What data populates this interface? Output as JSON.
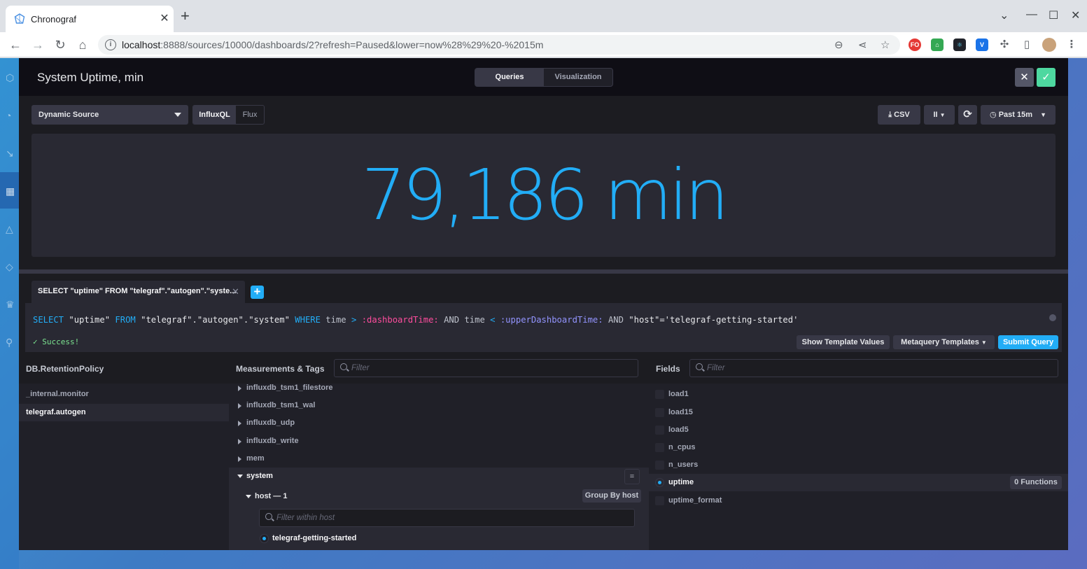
{
  "browser": {
    "tab_title": "Chronograf",
    "tab_close": "✕",
    "new_tab": "+",
    "url_host": "localhost",
    "url_rest": ":8888/sources/10000/dashboards/2?refresh=Paused&lower=now%28%29%20-%2015m"
  },
  "overlay": {
    "title": "System Uptime, min",
    "tabs": [
      "Queries",
      "Visualization"
    ],
    "active_tab": "Queries"
  },
  "toolbar": {
    "source_dropdown": "Dynamic Source",
    "languages": [
      "InfluxQL",
      "Flux"
    ],
    "active_language": "InfluxQL",
    "csv_label": "CSV",
    "pause_label": "II",
    "time_range": "Past 15m"
  },
  "graph": {
    "value": "79,186",
    "unit": "min",
    "color": "#22adf6"
  },
  "query_tabs": [
    {
      "label": "SELECT \"uptime\" FROM \"telegraf\".\"autogen\".\"syste..."
    }
  ],
  "editor": {
    "query_parts": {
      "select": "SELECT",
      "field": "\"uptime\"",
      "from": "FROM",
      "target": "\"telegraf\".\"autogen\".\"system\"",
      "where": "WHERE",
      "time1": "time",
      "gt": ">",
      "dashboard_time": ":dashboardTime:",
      "and1": "AND",
      "time2": "time",
      "lt": "<",
      "upper_time": ":upperDashboardTime:",
      "and2": "AND",
      "tag_clause": "\"host\"='telegraf-getting-started'"
    },
    "status": "Success!",
    "show_template_values": "Show Template Values",
    "metaquery_templates": "Metaquery Templates",
    "submit_query": "Submit Query"
  },
  "db_panel": {
    "title": "DB.RetentionPolicy",
    "items": [
      "_internal.monitor",
      "telegraf.autogen"
    ],
    "selected": "telegraf.autogen"
  },
  "measurements_panel": {
    "title": "Measurements & Tags",
    "filter_placeholder": "Filter",
    "items": [
      "influxdb_tsm1_filestore",
      "influxdb_tsm1_wal",
      "influxdb_udp",
      "influxdb_write",
      "mem",
      "system"
    ],
    "expanded": "system",
    "eq_label": "=",
    "tag_key": "host — 1",
    "group_by": "Group By host",
    "tag_filter_placeholder": "Filter within host",
    "tag_values": [
      "telegraf-getting-started"
    ]
  },
  "fields_panel": {
    "title": "Fields",
    "filter_placeholder": "Filter",
    "items": [
      "load1",
      "load15",
      "load5",
      "n_cpus",
      "n_users",
      "uptime",
      "uptime_format"
    ],
    "selected": "uptime",
    "functions_label": "0 Functions"
  }
}
